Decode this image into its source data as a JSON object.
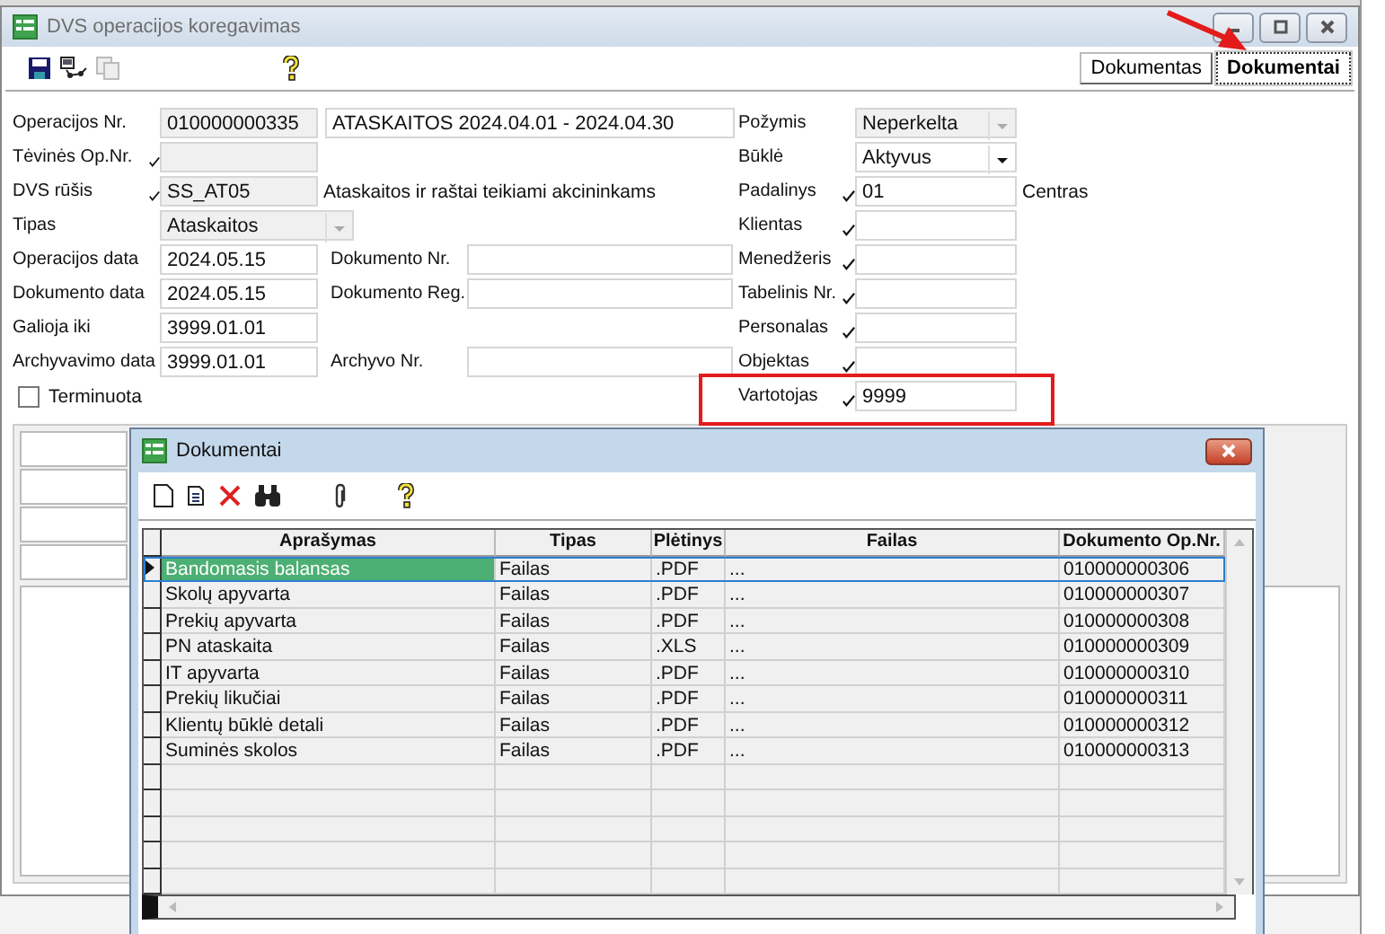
{
  "main_window": {
    "title": "DVS operacijos koregavimas",
    "tabs": [
      {
        "label": "Dokumentas",
        "selected": false
      },
      {
        "label": "Dokumentai",
        "selected": true
      }
    ],
    "left_fields": [
      {
        "label": "Operacijos Nr.",
        "lookup": false,
        "value": "010000000335",
        "readonly": true,
        "kind": "text",
        "extra_value": "ATASKAITOS 2024.04.01 - 2024.04.30"
      },
      {
        "label": "Tėvinės Op.Nr.",
        "lookup": true,
        "readonly": true,
        "kind": "text"
      },
      {
        "label": "DVS rūšis",
        "lookup": true,
        "value": "SS_AT05",
        "readonly": true,
        "kind": "text",
        "note": "Ataskaitos ir raštai teikiami akcininkams"
      },
      {
        "label": "Tipas",
        "lookup": false,
        "value": "Ataskaitos",
        "readonly": true,
        "kind": "dropdown"
      },
      {
        "label": "Operacijos data",
        "lookup": false,
        "value": "2024.05.15",
        "readonly": false,
        "kind": "text",
        "extra_label": "Dokumento Nr."
      },
      {
        "label": "Dokumento data",
        "lookup": false,
        "value": "2024.05.15",
        "readonly": false,
        "kind": "text",
        "extra_label": "Dokumento Reg."
      },
      {
        "label": "Galioja iki",
        "lookup": false,
        "value": "3999.01.01",
        "readonly": false,
        "kind": "text"
      },
      {
        "label": "Archyvavimo data",
        "lookup": false,
        "value": "3999.01.01",
        "readonly": false,
        "kind": "text",
        "extra_label": "Archyvo Nr."
      }
    ],
    "terminuota": {
      "label": "Terminuota",
      "checked": false
    },
    "right_fields": [
      {
        "label": "Požymis",
        "lookup": false,
        "value": "Neperkelta",
        "readonly": true,
        "kind": "dropdown"
      },
      {
        "label": "Būklė",
        "lookup": false,
        "value": "Aktyvus",
        "readonly": false,
        "kind": "dropdown"
      },
      {
        "label": "Padalinys",
        "lookup": true,
        "value": "01",
        "readonly": false,
        "kind": "text",
        "note": "Centras"
      },
      {
        "label": "Klientas",
        "lookup": true,
        "readonly": false,
        "kind": "text"
      },
      {
        "label": "Menedžeris",
        "lookup": true,
        "readonly": false,
        "kind": "text"
      },
      {
        "label": "Tabelinis Nr.",
        "lookup": true,
        "readonly": false,
        "kind": "text"
      },
      {
        "label": "Personalas",
        "lookup": true,
        "readonly": false,
        "kind": "text"
      },
      {
        "label": "Objektas",
        "lookup": true,
        "readonly": false,
        "kind": "text"
      },
      {
        "label": "Vartotojas",
        "lookup": true,
        "value": "9999",
        "readonly": false,
        "kind": "text"
      }
    ]
  },
  "documents_window": {
    "title": "Dokumentai",
    "columns": [
      "Aprašymas",
      "Tipas",
      "Plėtinys",
      "Failas",
      "Dokumento Op.Nr."
    ],
    "rows": [
      {
        "cells": [
          "Bandomasis balansas",
          "Failas",
          ".PDF",
          "...",
          "010000000306"
        ],
        "selected": true
      },
      {
        "cells": [
          "Skolų apyvarta",
          "Failas",
          ".PDF",
          "...",
          "010000000307"
        ],
        "selected": false
      },
      {
        "cells": [
          "Prekių apyvarta",
          "Failas",
          ".PDF",
          "...",
          "010000000308"
        ],
        "selected": false
      },
      {
        "cells": [
          "PN ataskaita",
          "Failas",
          ".XLS",
          "...",
          "010000000309"
        ],
        "selected": false
      },
      {
        "cells": [
          "IT apyvarta",
          "Failas",
          ".PDF",
          "...",
          "010000000310"
        ],
        "selected": false
      },
      {
        "cells": [
          "Prekių likučiai",
          "Failas",
          ".PDF",
          "...",
          "010000000311"
        ],
        "selected": false
      },
      {
        "cells": [
          "Klientų būklė detali",
          "Failas",
          ".PDF",
          "...",
          "010000000312"
        ],
        "selected": false
      },
      {
        "cells": [
          "Suminės skolos",
          "Failas",
          ".PDF",
          "...",
          "010000000313"
        ],
        "selected": false
      }
    ]
  }
}
